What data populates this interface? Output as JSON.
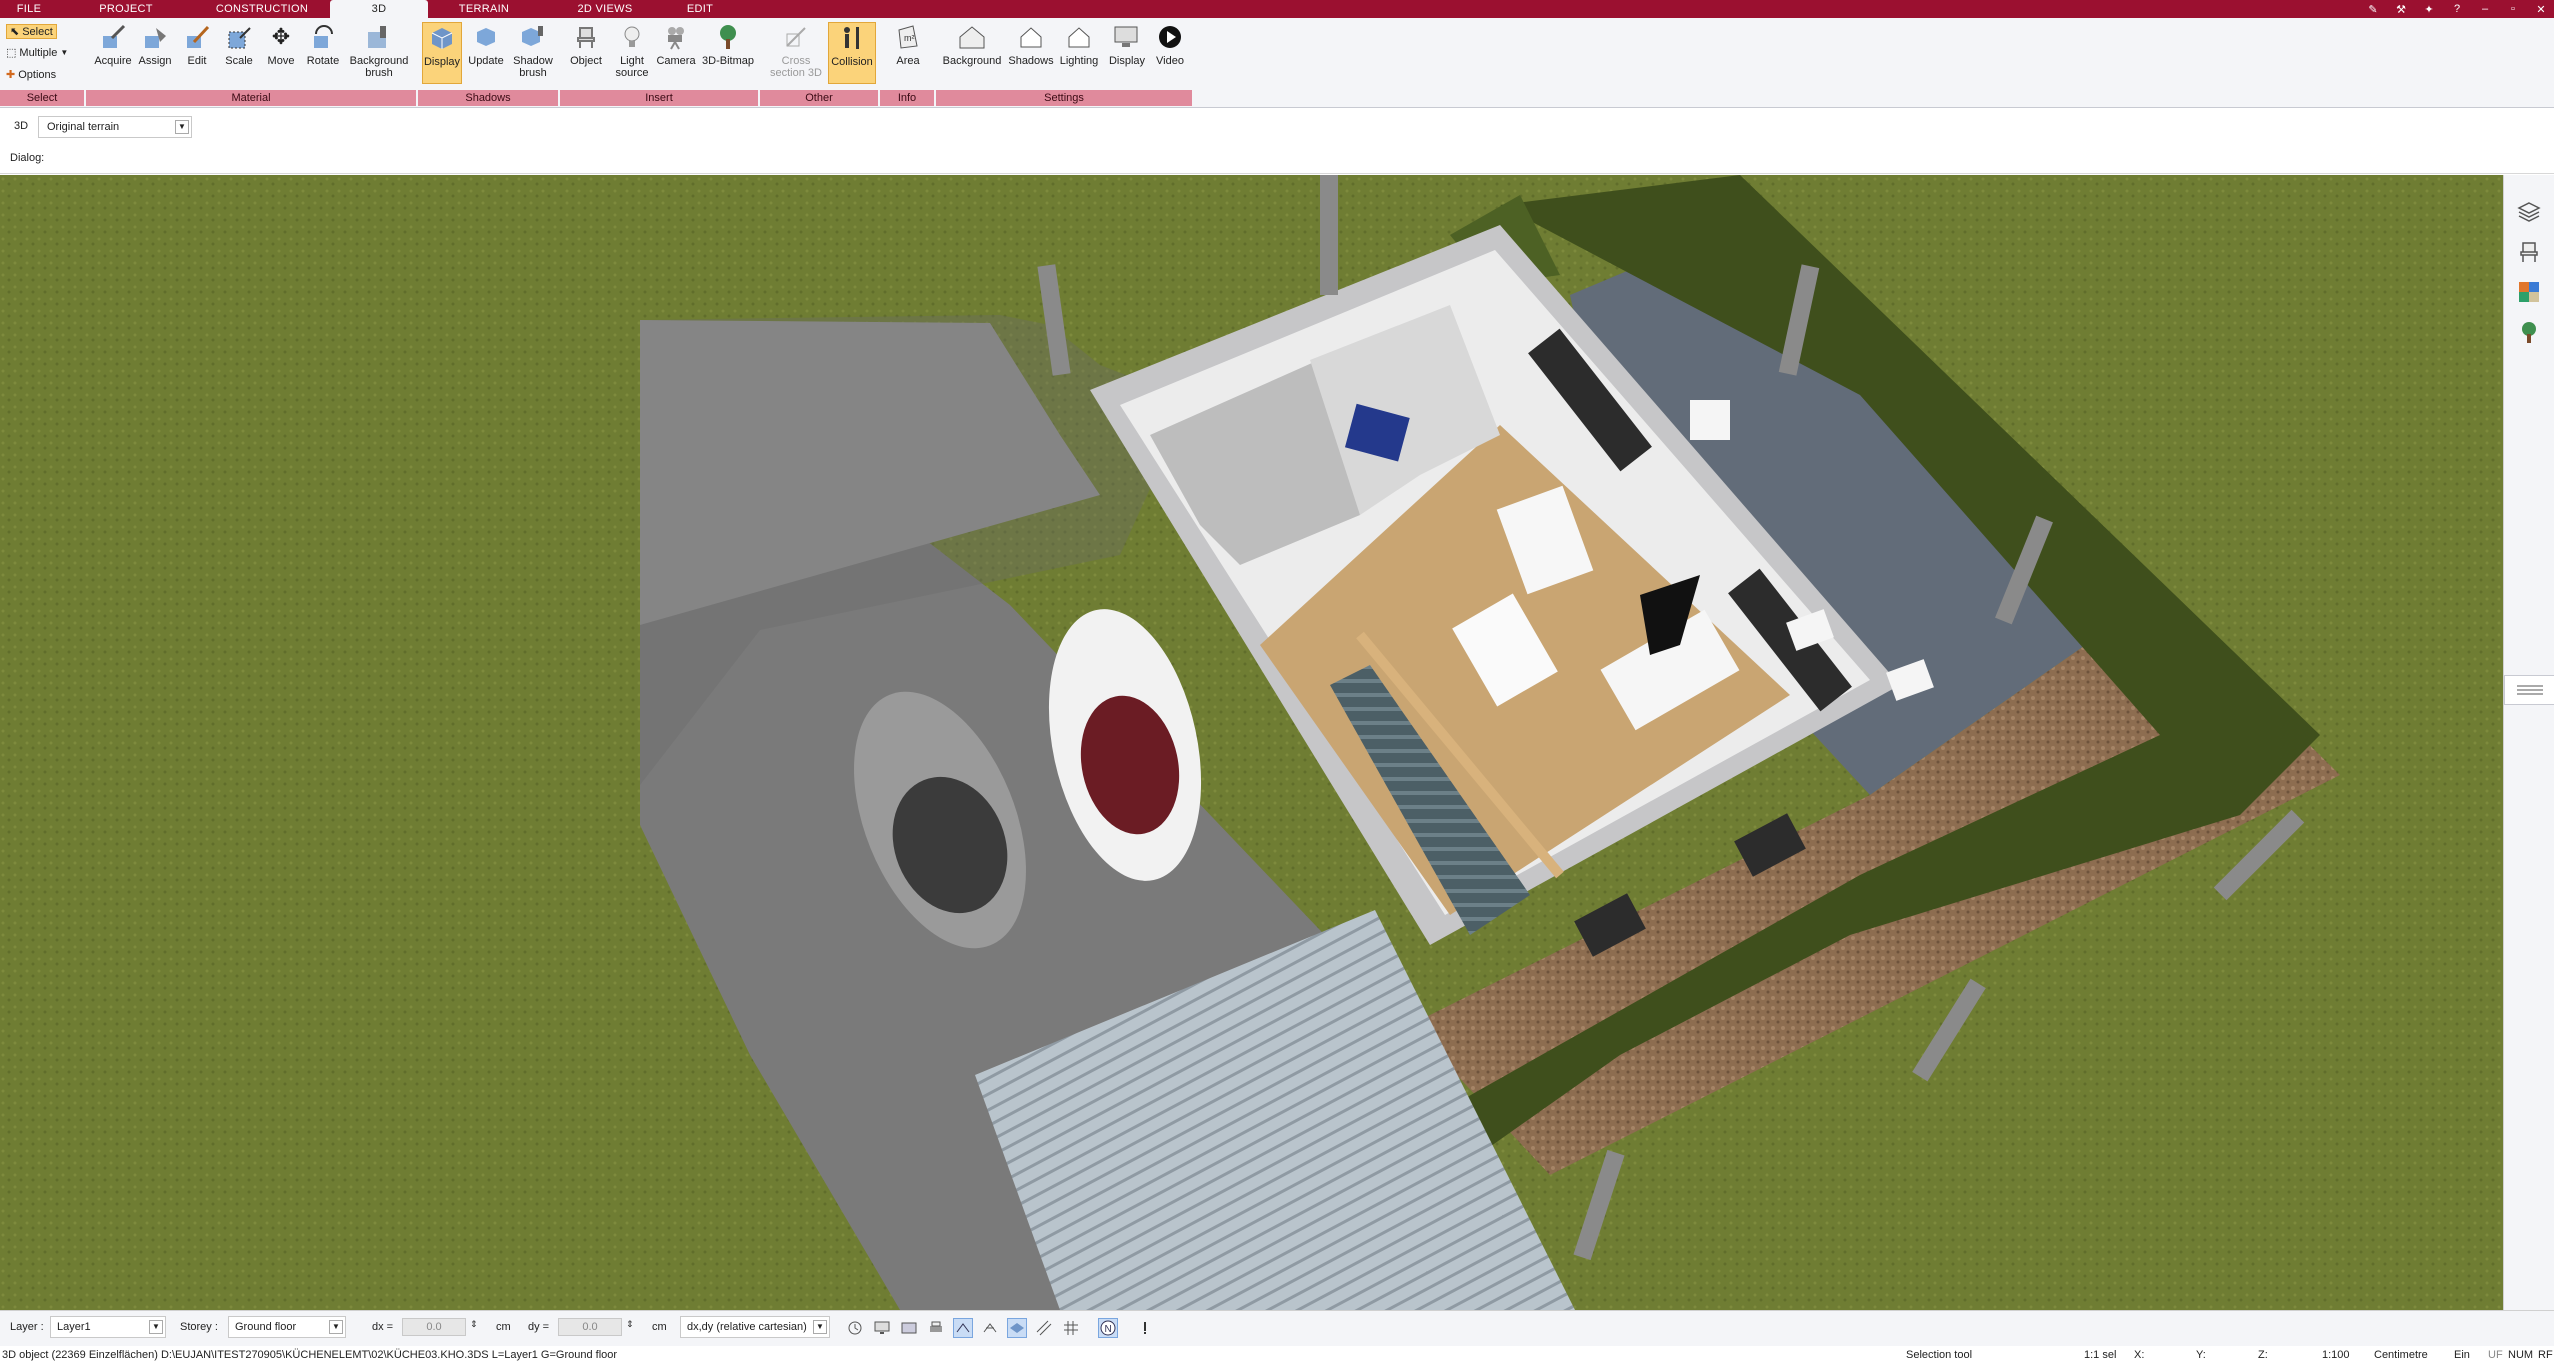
{
  "menubar": {
    "tabs": [
      "FILE",
      "PROJECT",
      "CONSTRUCTION",
      "3D",
      "TERRAIN",
      "2D VIEWS",
      "EDIT"
    ],
    "active_tab": "3D"
  },
  "ribbon": {
    "select_group": {
      "select_label": "Select",
      "multiple_label": "Multiple",
      "options_label": "Options",
      "group_label": "Select"
    },
    "material_group": {
      "buttons": [
        "Acquire",
        "Assign",
        "Edit",
        "Scale",
        "Move",
        "Rotate",
        "Background brush"
      ],
      "group_label": "Material"
    },
    "shadows_group": {
      "buttons": [
        "Display",
        "Update",
        "Shadow brush"
      ],
      "group_label": "Shadows"
    },
    "insert_group": {
      "buttons": [
        "Object",
        "Light source",
        "Camera",
        "3D-Bitmap"
      ],
      "group_label": "Insert"
    },
    "other_group": {
      "buttons": [
        "Cross section 3D",
        "Collision"
      ],
      "group_label": "Other"
    },
    "info_group": {
      "buttons": [
        "Area"
      ],
      "group_label": "Info"
    },
    "settings_group": {
      "buttons": [
        "Background",
        "Shadows",
        "Lighting",
        "Display",
        "Video"
      ],
      "group_label": "Settings"
    }
  },
  "view": {
    "tag": "3D",
    "selected": "Original terrain"
  },
  "dialog": {
    "label": "Dialog:"
  },
  "statusbar": {
    "layer_label": "Layer :",
    "layer_value": "Layer1",
    "storey_label": "Storey :",
    "storey_value": "Ground floor",
    "dx_label": "dx =",
    "dx_value": "0.0",
    "dx_unit": "cm",
    "dy_label": "dy =",
    "dy_value": "0.0",
    "dy_unit": "cm",
    "coord_mode": "dx,dy (relative cartesian)"
  },
  "infobar": {
    "object_info": "3D object (22369 Einzelflächen) D:\\EUJAN\\ITEST270905\\KÜCHENELEMT\\02\\KÜCHE03.KHO.3DS L=Layer1 G=Ground floor",
    "tool": "Selection tool",
    "selection": "1:1 sel",
    "x_label": "X:",
    "y_label": "Y:",
    "z_label": "Z:",
    "scale": "1:100",
    "unit": "Centimetre",
    "mode": "Ein",
    "uf": "UF",
    "num": "NUM",
    "rf": "RF"
  },
  "colors": {
    "brand": "#9b1030",
    "group_label_bg": "#e08a9c",
    "active_button": "#fbd37a",
    "grass": "#6c7a31"
  }
}
